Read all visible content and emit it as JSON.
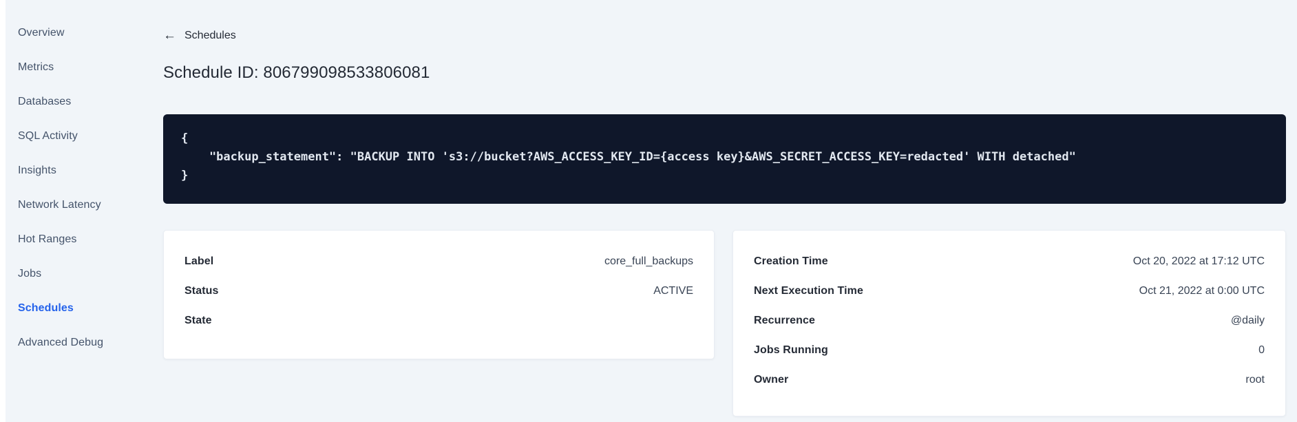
{
  "sidebar": {
    "items": [
      {
        "label": "Overview",
        "active": false
      },
      {
        "label": "Metrics",
        "active": false
      },
      {
        "label": "Databases",
        "active": false
      },
      {
        "label": "SQL Activity",
        "active": false
      },
      {
        "label": "Insights",
        "active": false
      },
      {
        "label": "Network Latency",
        "active": false
      },
      {
        "label": "Hot Ranges",
        "active": false
      },
      {
        "label": "Jobs",
        "active": false
      },
      {
        "label": "Schedules",
        "active": true
      },
      {
        "label": "Advanced Debug",
        "active": false
      }
    ]
  },
  "header": {
    "back_label": "Schedules",
    "back_icon": "left-arrow-icon",
    "title": "Schedule ID: 806799098533806081"
  },
  "code_block": {
    "text": "{\n    \"backup_statement\": \"BACKUP INTO 's3://bucket?AWS_ACCESS_KEY_ID={access key}&AWS_SECRET_ACCESS_KEY=redacted' WITH detached\"\n}"
  },
  "cards": {
    "left": {
      "rows": [
        {
          "label": "Label",
          "value": "core_full_backups"
        },
        {
          "label": "Status",
          "value": "ACTIVE"
        },
        {
          "label": "State",
          "value": ""
        }
      ]
    },
    "right": {
      "rows": [
        {
          "label": "Creation Time",
          "value": "Oct 20, 2022 at 17:12 UTC"
        },
        {
          "label": "Next Execution Time",
          "value": "Oct 21, 2022 at 0:00 UTC"
        },
        {
          "label": "Recurrence",
          "value": "@daily"
        },
        {
          "label": "Jobs Running",
          "value": "0"
        },
        {
          "label": "Owner",
          "value": "root"
        }
      ]
    }
  },
  "colors": {
    "accent_blue": "#2563eb",
    "code_background": "#0f172a",
    "page_background": "#f1f5f9",
    "text_dark": "#242a35"
  }
}
